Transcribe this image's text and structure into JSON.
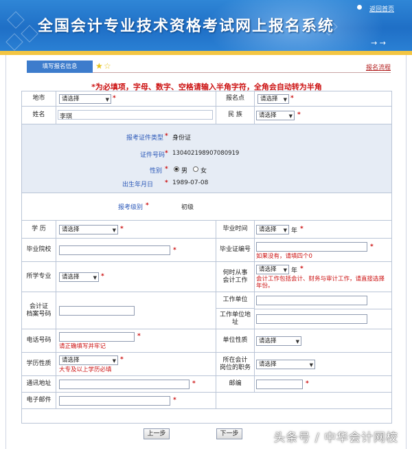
{
  "header": {
    "title": "全国会计专业技术资格考试网上报名系统",
    "home_link": "返回首页"
  },
  "tabs": {
    "active_tab": "填写报名信息",
    "process_link": "报名流程"
  },
  "notice": "*为必填项，字母、数字、空格请输入半角字符，全角会自动转为半角",
  "select_placeholder": "请选择",
  "form": {
    "region_label": "地市",
    "exam_site_label": "报名点",
    "name_label": "姓名",
    "name_value": "李琪",
    "ethnicity_label": "民 族",
    "id_type_label": "报考证件类型",
    "id_type_value": "身份证",
    "id_number_label": "证件号码",
    "id_number_value": "130402198907080919",
    "gender_label": "性别",
    "gender_male": "男",
    "gender_female": "女",
    "gender_selected": "男",
    "birth_label": "出生年月日",
    "birth_value": "1989-07-08",
    "level_label": "报考级别",
    "level_value": "初级",
    "education_label": "学 历",
    "grad_time_label": "毕业时间",
    "year_unit": "年",
    "school_label": "毕业院校",
    "cert_no_label": "毕业证编号",
    "cert_no_hint": "如果没有，请填四个0",
    "major_label": "所学专业",
    "work_start_label": "何时从事\n会计工作",
    "work_start_hint": "会计工作包括会计、财务与审计工作，请直接选择年份。",
    "archive_label": "会计证\n档案号码",
    "employer_label": "工作单位",
    "employer_addr_label": "工作单位地址",
    "phone_label": "电话号码",
    "phone_hint": "请正确填写并牢记",
    "unit_type_label": "单位性质",
    "edu_type_label": "学历性质",
    "edu_type_hint": "大专及以上学历必填",
    "position_label": "所在会计\n岗位的职务",
    "address_label": "通讯地址",
    "zip_label": "邮编",
    "email_label": "电子邮件",
    "required_mark": "*"
  },
  "buttons": {
    "prev": "上一步",
    "next": "下一步"
  },
  "watermark": "头条号 / 中华会计网校",
  "colors": {
    "banner": "#1f6fc6",
    "accent_bar": "#f3c542",
    "required": "#cc1111",
    "tab": "#3d7ccc"
  }
}
